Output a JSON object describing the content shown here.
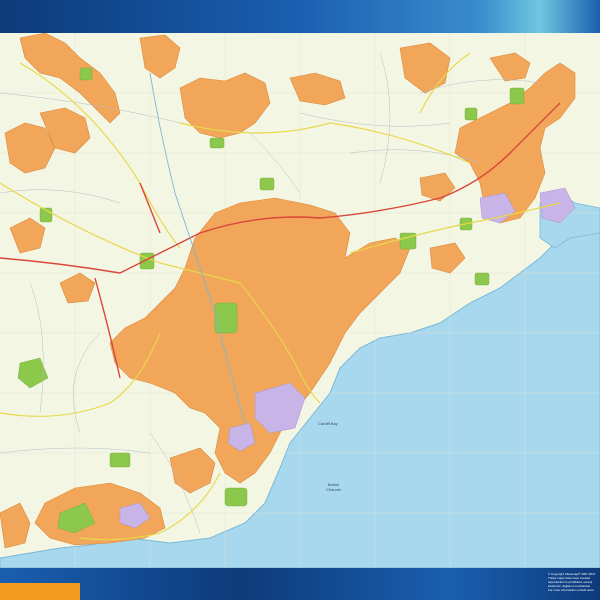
{
  "map": {
    "colors": {
      "land": "#f4f6e4",
      "urban": "#f2a65a",
      "urban_outline": "#d98a3c",
      "park": "#8cc84b",
      "industrial": "#c8b4e6",
      "sea": "#a8d8ee",
      "coast": "#7ab8d6",
      "motorway": "#d9463a",
      "primary_road": "#e8d84a",
      "minor_road": "#b8bcc4",
      "frame_blue": "#1a5fb0",
      "frame_dark": "#0d3a7a",
      "frame_cyan": "#6fc6e0",
      "tab_orange": "#f39a1f"
    },
    "labels": {
      "sea_name_line1": "Bristol",
      "sea_name_line2": "Channel",
      "bay": "Cardiff Bay"
    },
    "copyright_lines": [
      "© Copyright Citiesmap® 1997-2017",
      "These maps have been created",
      "reproduction is prohibited, except",
      "electronic, digital or mechanical",
      "For more information consult www"
    ]
  }
}
